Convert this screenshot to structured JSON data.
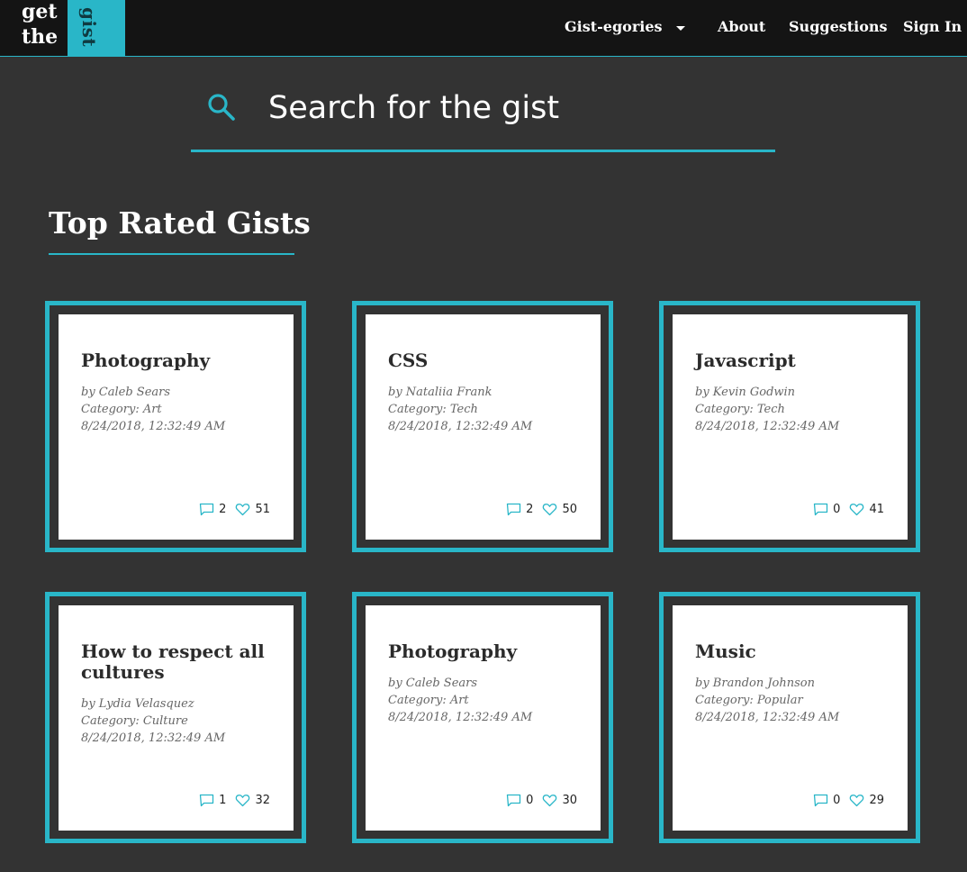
{
  "logo": {
    "word1": "get",
    "word2": "the",
    "word3": "gist"
  },
  "nav": {
    "categories": "Gist-egories",
    "about": "About",
    "suggestions": "Suggestions",
    "sign_in": "Sign In"
  },
  "search": {
    "placeholder": "Search for the gist"
  },
  "section_title": "Top Rated Gists",
  "colors": {
    "accent": "#29b6c8",
    "background": "#333333",
    "navbar": "#141414"
  },
  "cards": [
    {
      "title": "Photography",
      "author": "by Caleb Sears",
      "category": "Category: Art",
      "date": "8/24/2018, 12:32:49 AM",
      "comments": "2",
      "likes": "51"
    },
    {
      "title": "CSS",
      "author": "by Nataliia Frank",
      "category": "Category: Tech",
      "date": "8/24/2018, 12:32:49 AM",
      "comments": "2",
      "likes": "50"
    },
    {
      "title": "Javascript",
      "author": "by Kevin Godwin",
      "category": "Category: Tech",
      "date": "8/24/2018, 12:32:49 AM",
      "comments": "0",
      "likes": "41"
    },
    {
      "title": "How to respect all cultures",
      "author": "by Lydia Velasquez",
      "category": "Category: Culture",
      "date": "8/24/2018, 12:32:49 AM",
      "comments": "1",
      "likes": "32"
    },
    {
      "title": "Photography",
      "author": "by Caleb Sears",
      "category": "Category: Art",
      "date": "8/24/2018, 12:32:49 AM",
      "comments": "0",
      "likes": "30"
    },
    {
      "title": "Music",
      "author": "by Brandon Johnson",
      "category": "Category: Popular",
      "date": "8/24/2018, 12:32:49 AM",
      "comments": "0",
      "likes": "29"
    }
  ]
}
